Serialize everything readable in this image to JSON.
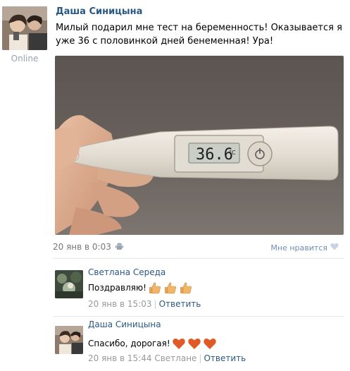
{
  "post": {
    "author": "Даша Синицына",
    "status": "Online",
    "text": "Милый подарил мне тест на беременность! Оказывается я уже 36 с половинкой дней бенеменная! Ура!",
    "date": "20 янв в 0:03",
    "like_label": "Мне нравится",
    "photo": {
      "display_value": "36.6",
      "display_unit": "°C"
    }
  },
  "comments": [
    {
      "author": "Светлана Середа",
      "text": "Поздравляю!",
      "emoji": [
        "thumbs-up-icon",
        "thumbs-up-icon",
        "thumbs-up-icon"
      ],
      "date": "20 янв в 15:03",
      "reply_label": "Ответить"
    },
    {
      "author": "Даша Синицына",
      "text": "Спасибо, дорогая!",
      "emoji": [
        "heart-icon",
        "heart-icon",
        "heart-icon"
      ],
      "date": "20 янв в 15:44",
      "reply_to": "Светлане",
      "reply_label": "Ответить"
    }
  ],
  "colors": {
    "link": "#2a5885",
    "meta": "#999999",
    "like": "#6d8fb3",
    "heart": "#e05a28",
    "thumb": "#f2b66a"
  }
}
